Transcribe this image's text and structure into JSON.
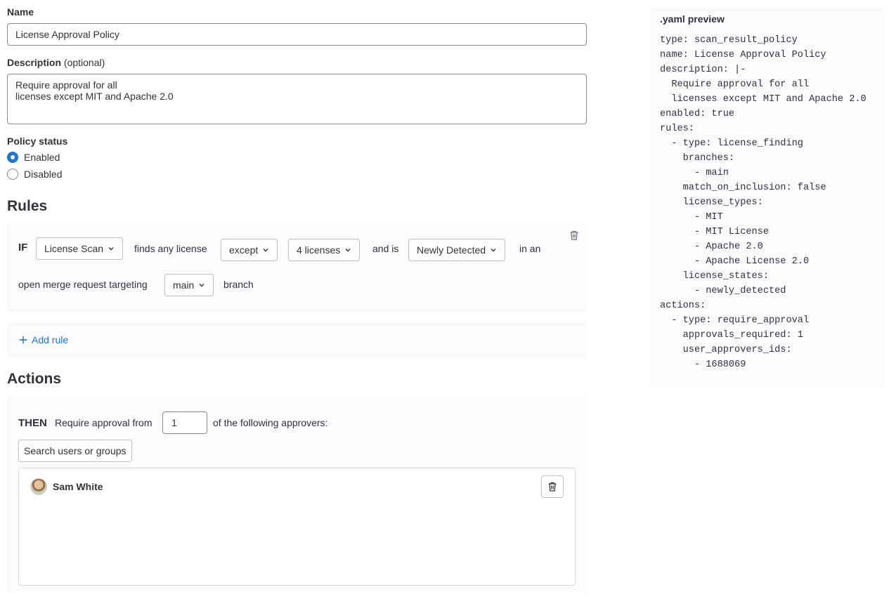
{
  "form": {
    "name_label": "Name",
    "name_value": "License Approval Policy",
    "description_label": "Description",
    "description_optional": "(optional)",
    "description_value": "Require approval for all\nlicenses except MIT and Apache 2.0",
    "status_label": "Policy status",
    "status_options": [
      {
        "label": "Enabled",
        "checked": true
      },
      {
        "label": "Disabled",
        "checked": false
      }
    ]
  },
  "rules": {
    "heading": "Rules",
    "if_keyword": "IF",
    "scanner": "License Scan",
    "text_finds": "finds any license",
    "operator": "except",
    "licenses": "4 licenses",
    "text_and_is": "and is",
    "state": "Newly Detected",
    "text_in_an": "in an",
    "text_open_mr": "open merge request targeting",
    "branch": "main",
    "text_branch": "branch",
    "add_rule": "Add rule"
  },
  "actions": {
    "heading": "Actions",
    "then_keyword": "THEN",
    "text_require": "Require approval from",
    "approvals_required": "1",
    "text_following": "of the following approvers:",
    "search_label": "Search users or groups",
    "approvers": [
      {
        "name": "Sam White"
      }
    ]
  },
  "yaml": {
    "title": ".yaml preview",
    "code": "type: scan_result_policy\nname: License Approval Policy\ndescription: |-\n  Require approval for all\n  licenses except MIT and Apache 2.0\nenabled: true\nrules:\n  - type: license_finding\n    branches:\n      - main\n    match_on_inclusion: false\n    license_types:\n      - MIT\n      - MIT License\n      - Apache 2.0\n      - Apache License 2.0\n    license_states:\n      - newly_detected\nactions:\n  - type: require_approval\n    approvals_required: 1\n    user_approvers_ids:\n      - 1688069"
  },
  "colors": {
    "accent": "#1f75cb",
    "panel_bg": "#fbfafd",
    "text": "#333238"
  }
}
